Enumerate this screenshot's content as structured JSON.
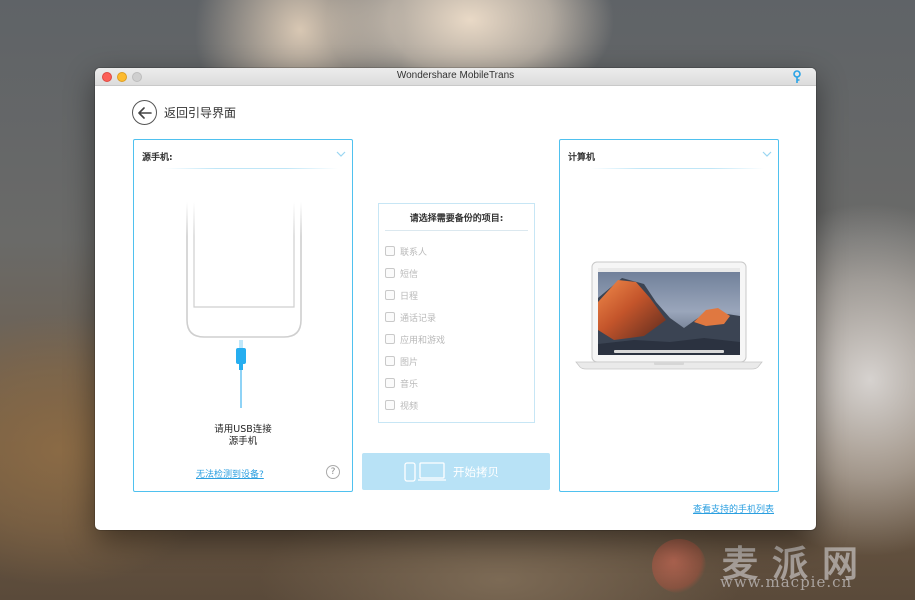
{
  "window": {
    "title": "Wondershare MobileTrans"
  },
  "nav": {
    "back_label": "返回引导界面"
  },
  "source_panel": {
    "title": "源手机:",
    "instruction_line1": "请用USB连接",
    "instruction_line2": "源手机",
    "detect_link": "无法检测到设备?",
    "help_label": "?"
  },
  "items_panel": {
    "heading": "请选择需要备份的项目:",
    "items": [
      {
        "label": "联系人",
        "checked": false
      },
      {
        "label": "短信",
        "checked": false
      },
      {
        "label": "日程",
        "checked": false
      },
      {
        "label": "通话记录",
        "checked": false
      },
      {
        "label": "应用和游戏",
        "checked": false
      },
      {
        "label": "图片",
        "checked": false
      },
      {
        "label": "音乐",
        "checked": false
      },
      {
        "label": "视频",
        "checked": false
      }
    ]
  },
  "start_button": {
    "label": "开始拷贝",
    "enabled": false
  },
  "dest_panel": {
    "title": "计算机"
  },
  "footer": {
    "support_link": "查看支持的手机列表"
  },
  "watermark": {
    "title": "麦派网",
    "url": "www.macpie.cn"
  },
  "colors": {
    "accent": "#4fc1ef",
    "link": "#2b9fe0",
    "button_disabled": "#b8e2f6"
  }
}
